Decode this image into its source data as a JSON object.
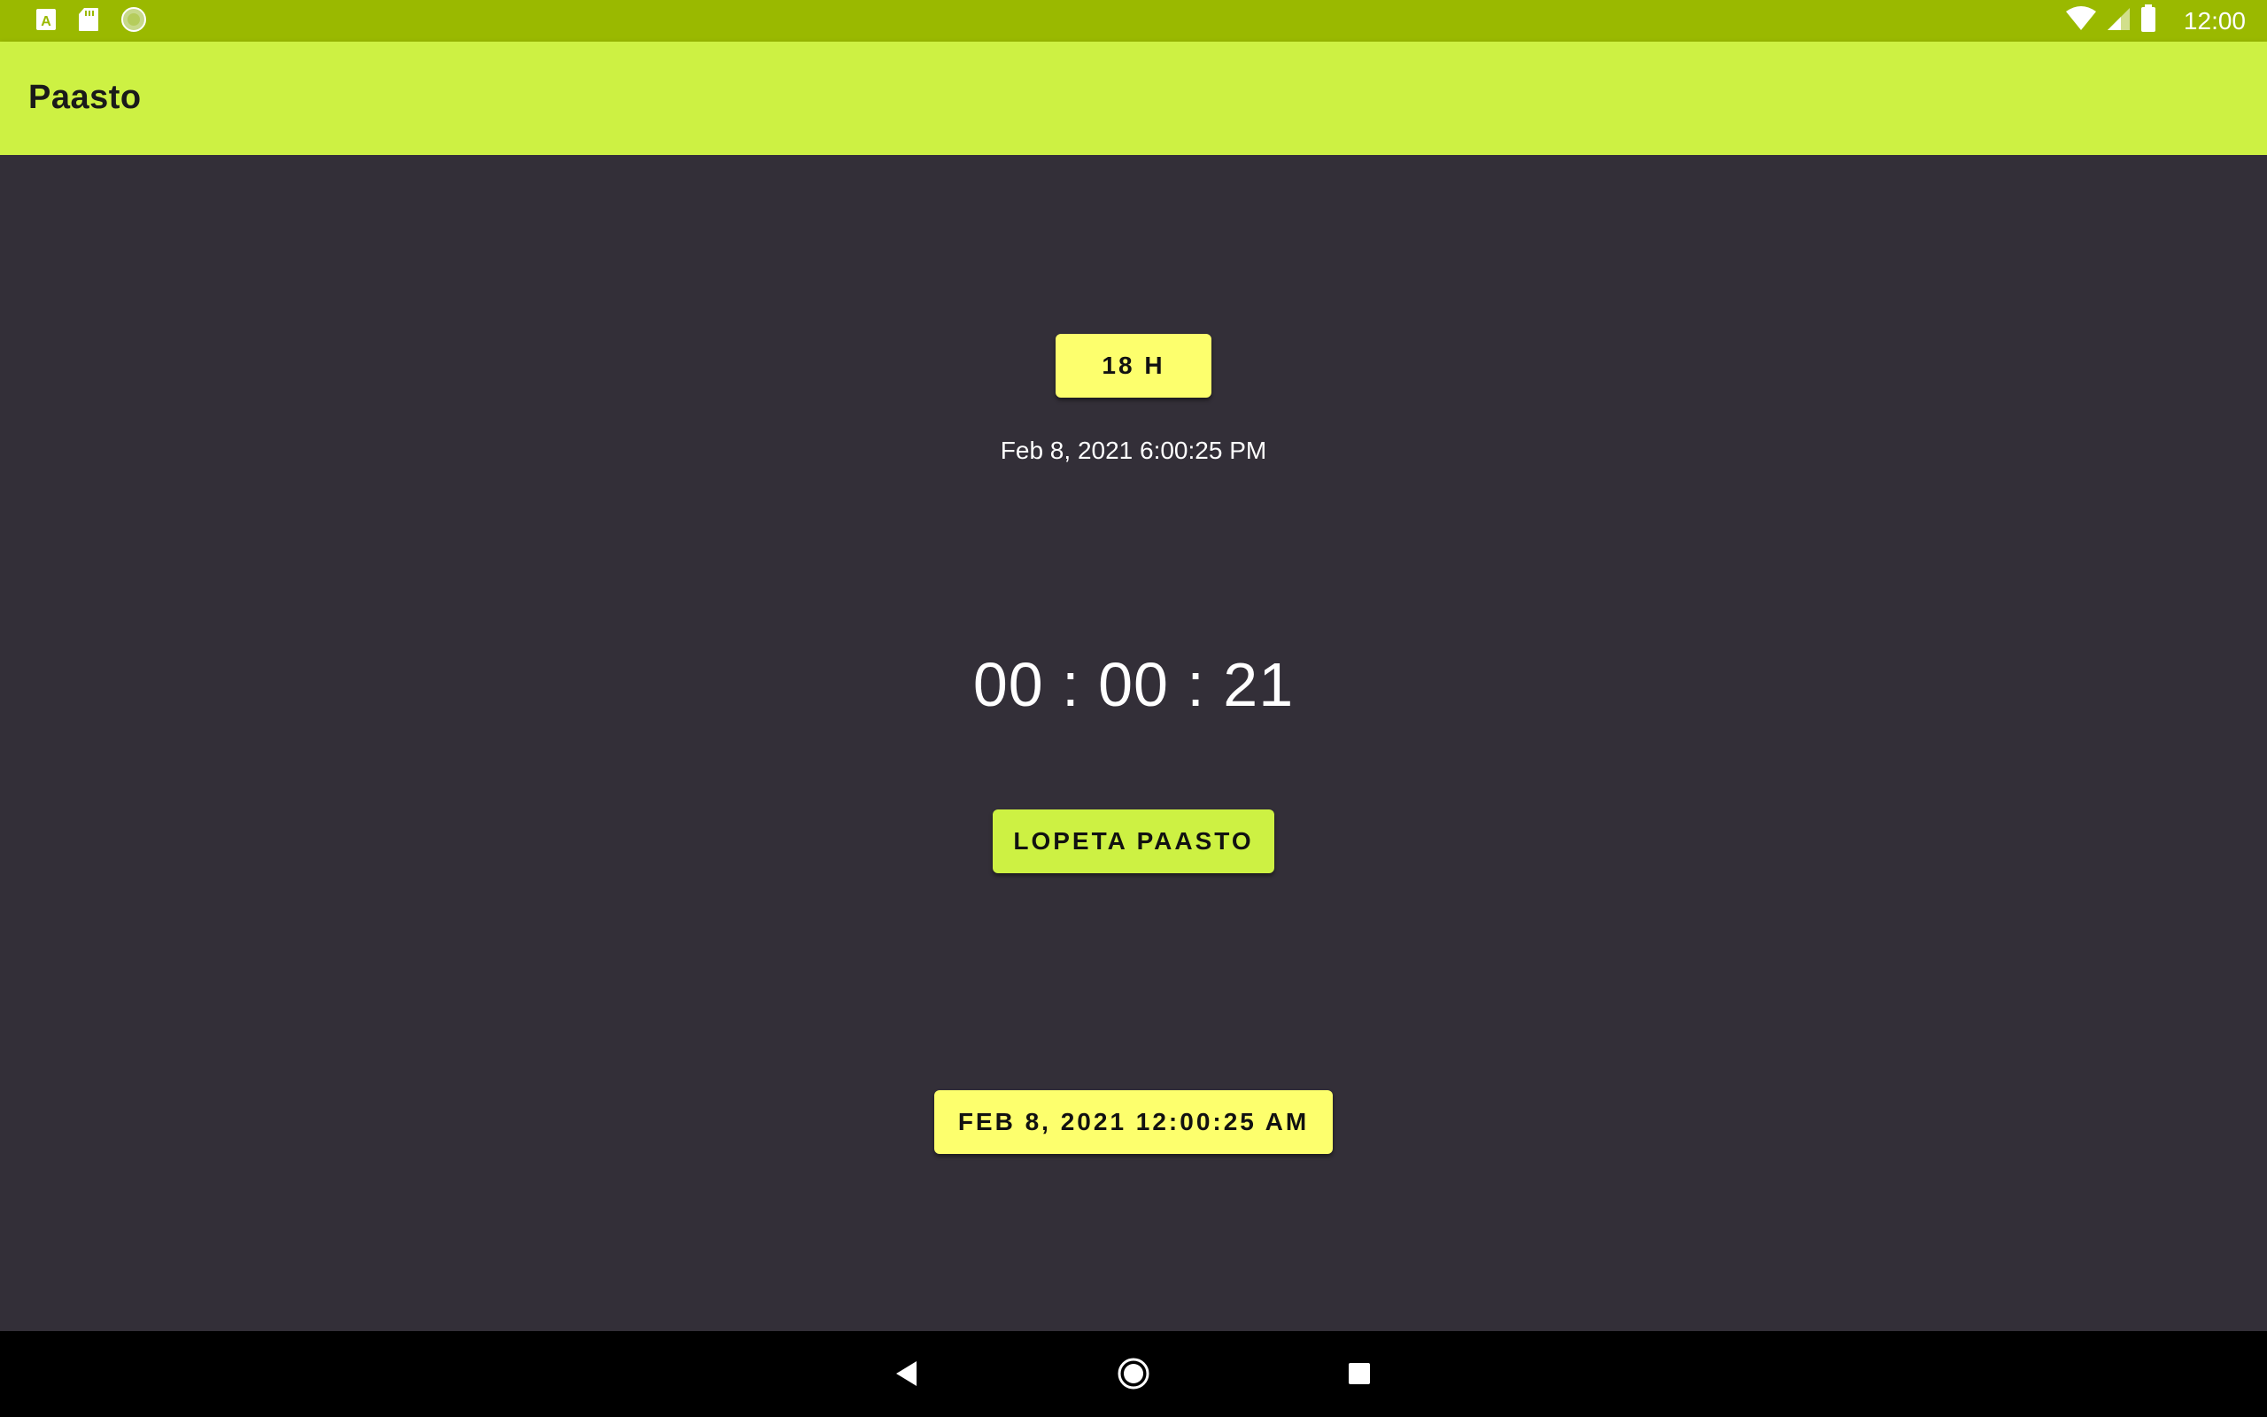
{
  "status_bar": {
    "time": "12:00",
    "icons_left": [
      "keyboard-a-icon",
      "sd-card-icon",
      "sync-circle-icon"
    ],
    "icons_right": [
      "wifi-icon",
      "signal-icon",
      "battery-icon"
    ],
    "color": "#9ab900"
  },
  "app_bar": {
    "title": "Paasto",
    "color": "#cdf143"
  },
  "main": {
    "hours_button_label": "18 H",
    "start_time": "Feb 8, 2021 6:00:25 PM",
    "timer": "00 : 00 : 21",
    "stop_button_label": "LOPETA PAASTO",
    "date_button_label": "FEB 8, 2021 12:00:25 AM",
    "background": "#332f38",
    "accent_yellow": "#fdff6d",
    "accent_lime": "#cdf143"
  },
  "nav_bar": {
    "buttons": [
      "back-icon",
      "home-icon",
      "recents-icon"
    ]
  }
}
